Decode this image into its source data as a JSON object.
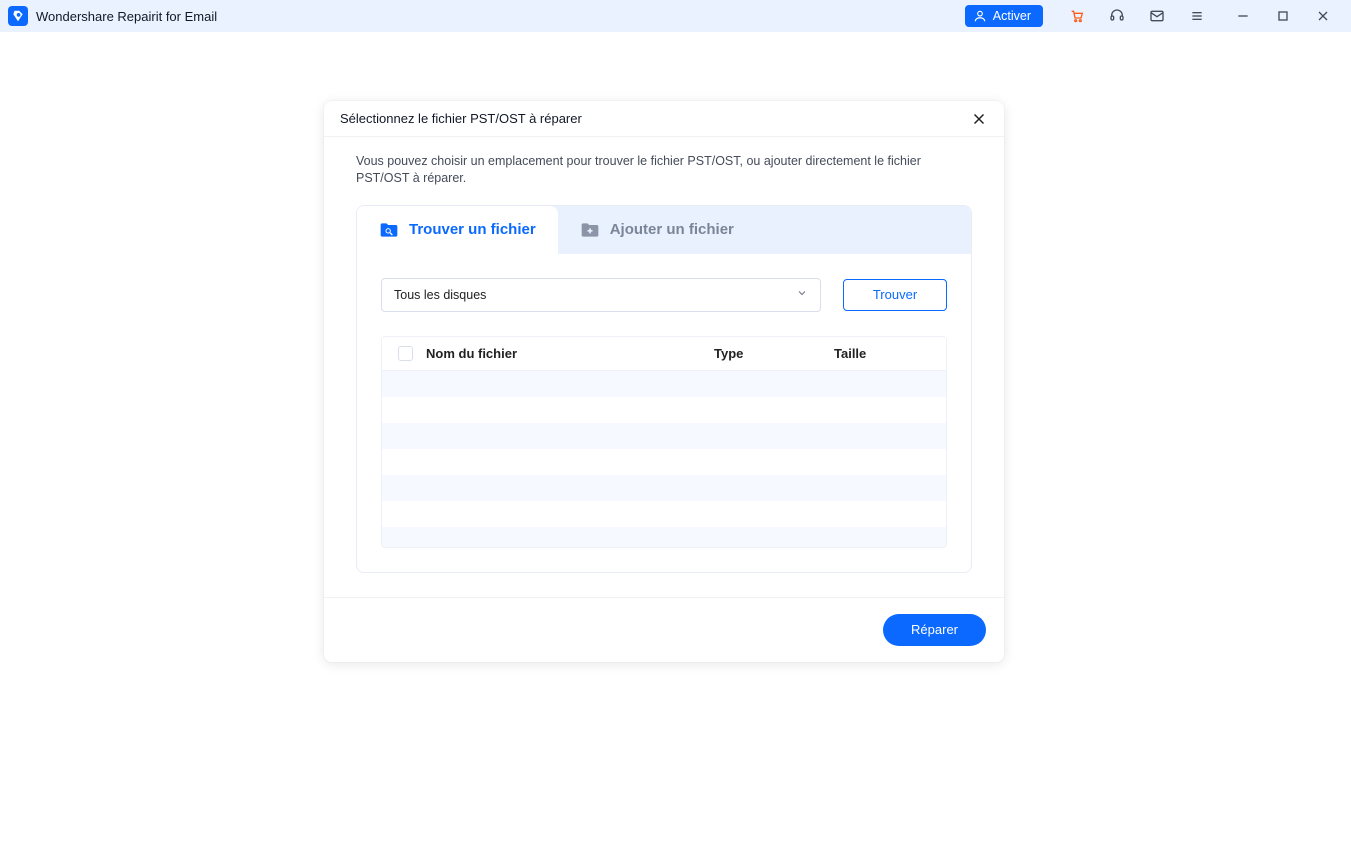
{
  "titlebar": {
    "app_title": "Wondershare Repairit for Email",
    "activate_label": "Activer"
  },
  "modal": {
    "title": "Sélectionnez le fichier PST/OST à réparer",
    "description": "Vous pouvez choisir un emplacement pour trouver le fichier PST/OST, ou ajouter directement le fichier PST/OST à réparer.",
    "tabs": {
      "find": "Trouver un fichier",
      "add": "Ajouter un fichier"
    },
    "select_value": "Tous les disques",
    "find_button": "Trouver",
    "columns": {
      "name": "Nom du fichier",
      "type": "Type",
      "size": "Taille"
    },
    "repair_button": "Réparer"
  },
  "colors": {
    "accent": "#0b69ff",
    "titlebar_bg": "#eaf2ff",
    "tabs_bg": "#e9f1ff",
    "cart": "#ff5b18"
  }
}
